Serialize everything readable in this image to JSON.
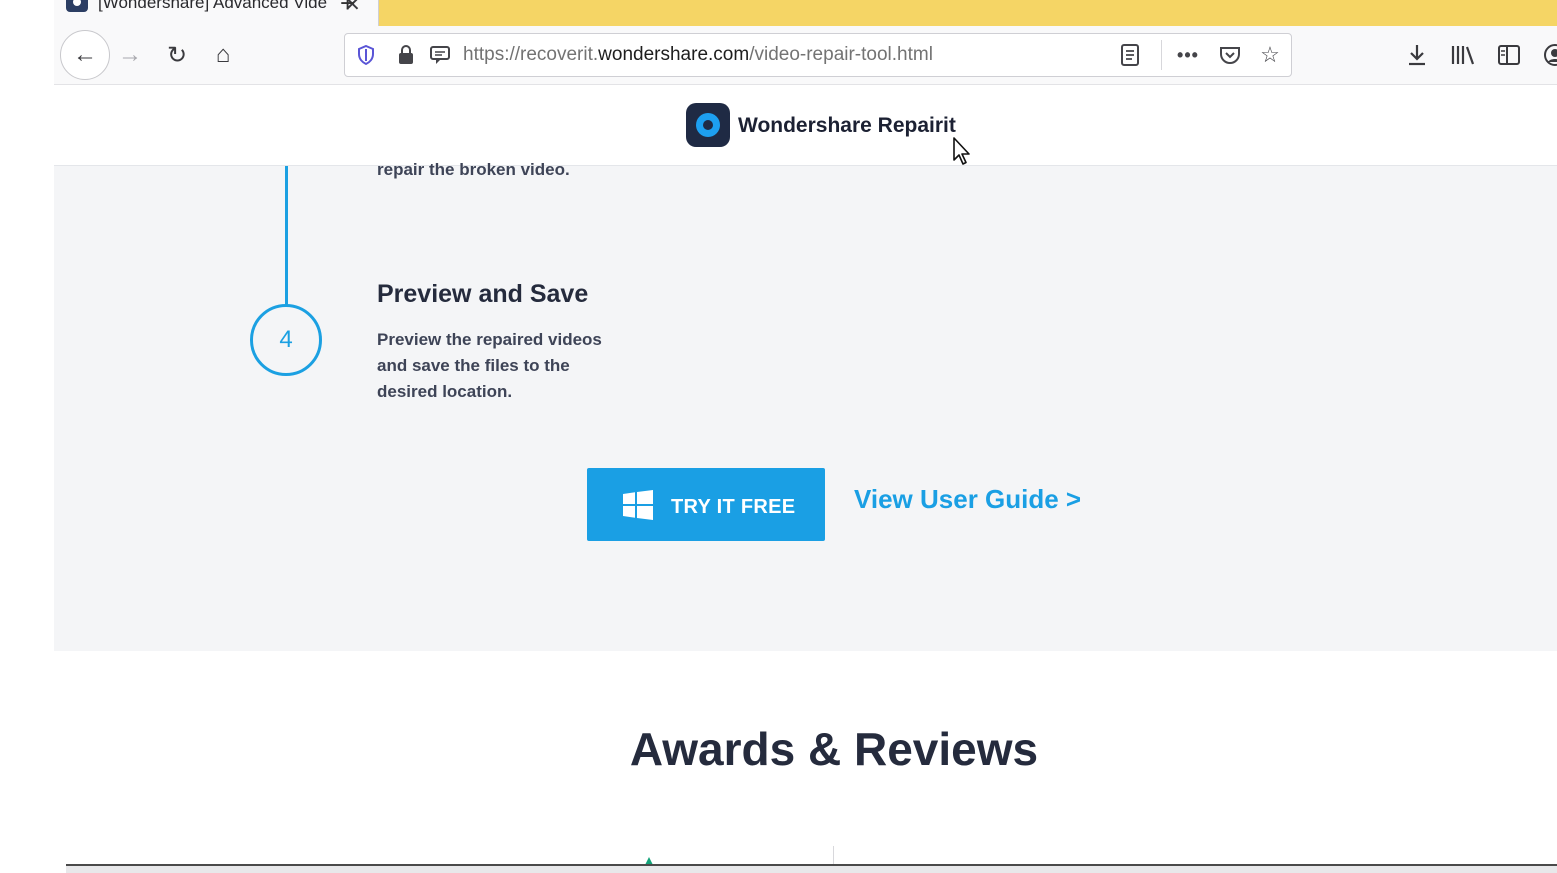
{
  "browser": {
    "tab": {
      "title": "[Wondershare] Advanced Vide",
      "close_glyph": "✕"
    },
    "new_tab_glyph": "+",
    "url": {
      "prefix": "https://recoverit.",
      "domain": "wondershare.com",
      "path": "/video-repair-tool.html"
    },
    "icons": {
      "back": "←",
      "forward": "→",
      "reload": "↻",
      "home": "⌂",
      "shield": "⛉",
      "lock": "🔒",
      "permissions": "▭",
      "reader": "▤",
      "more": "•••",
      "pocket": "♡",
      "star": "☆",
      "downloads": "⤓",
      "library": "|||\\",
      "sidebar": "◫",
      "account": "◉"
    }
  },
  "site": {
    "brand": "Wondershare Repairit"
  },
  "steps": {
    "previous_desc": "repair the broken video.",
    "current": {
      "number": "4",
      "title": "Preview and Save",
      "description": "Preview the repaired videos and save the files to the desired location."
    },
    "accent_color": "#1ba0e2"
  },
  "cta": {
    "try_free_label": "TRY IT FREE",
    "user_guide_label": "View User Guide >"
  },
  "awards": {
    "title": "Awards & Reviews"
  }
}
